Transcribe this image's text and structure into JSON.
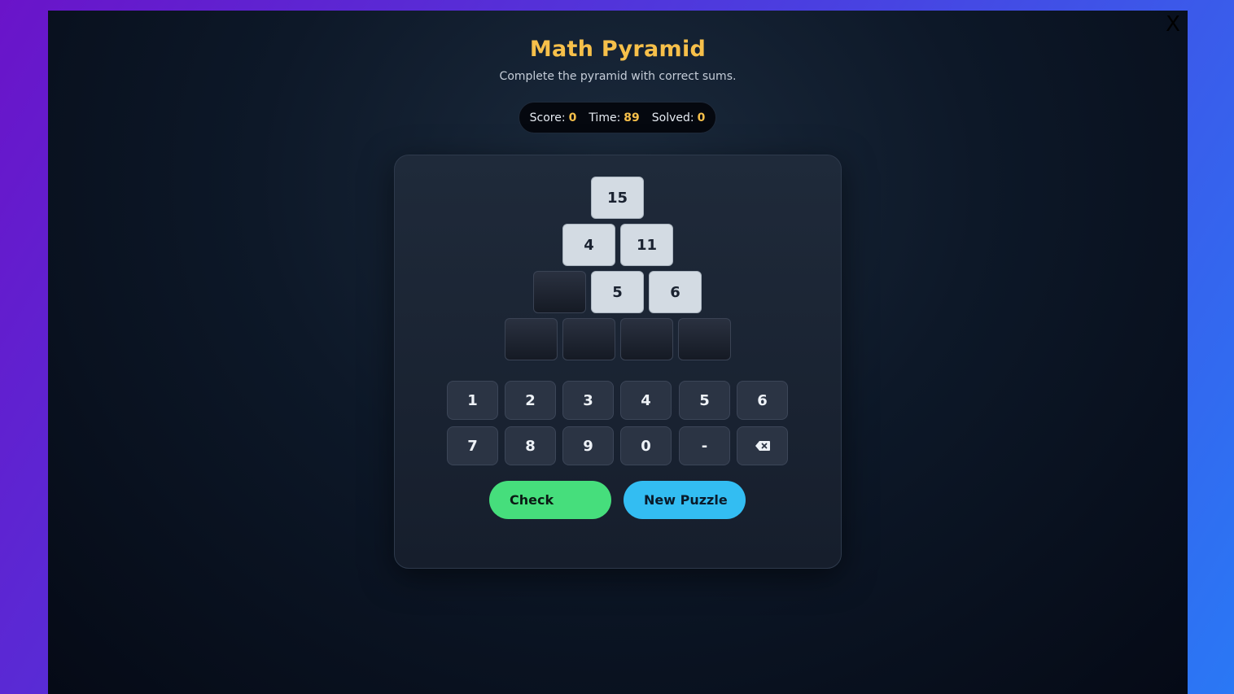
{
  "game": {
    "title": "Math Pyramid",
    "subtitle": "Complete the pyramid with correct sums.",
    "close_label": "X"
  },
  "stats": {
    "score_label": "Score:",
    "score": "0",
    "time_label": "Time:",
    "time": "89",
    "solved_label": "Solved:",
    "solved": "0"
  },
  "pyramid": {
    "rows": [
      [
        "15"
      ],
      [
        "4",
        "11"
      ],
      [
        "",
        "5",
        "6"
      ],
      [
        "",
        "",
        "",
        ""
      ]
    ]
  },
  "keypad": {
    "keys": [
      "1",
      "2",
      "3",
      "4",
      "5",
      "6",
      "7",
      "8",
      "9",
      "0",
      "-"
    ],
    "backspace_icon": "backspace-icon"
  },
  "actions": {
    "check_label": "Check",
    "new_puzzle_label": "New Puzzle"
  },
  "colors": {
    "accent": "#f7c04a",
    "check": "#46de7c",
    "new_puzzle": "#33bdf2"
  }
}
